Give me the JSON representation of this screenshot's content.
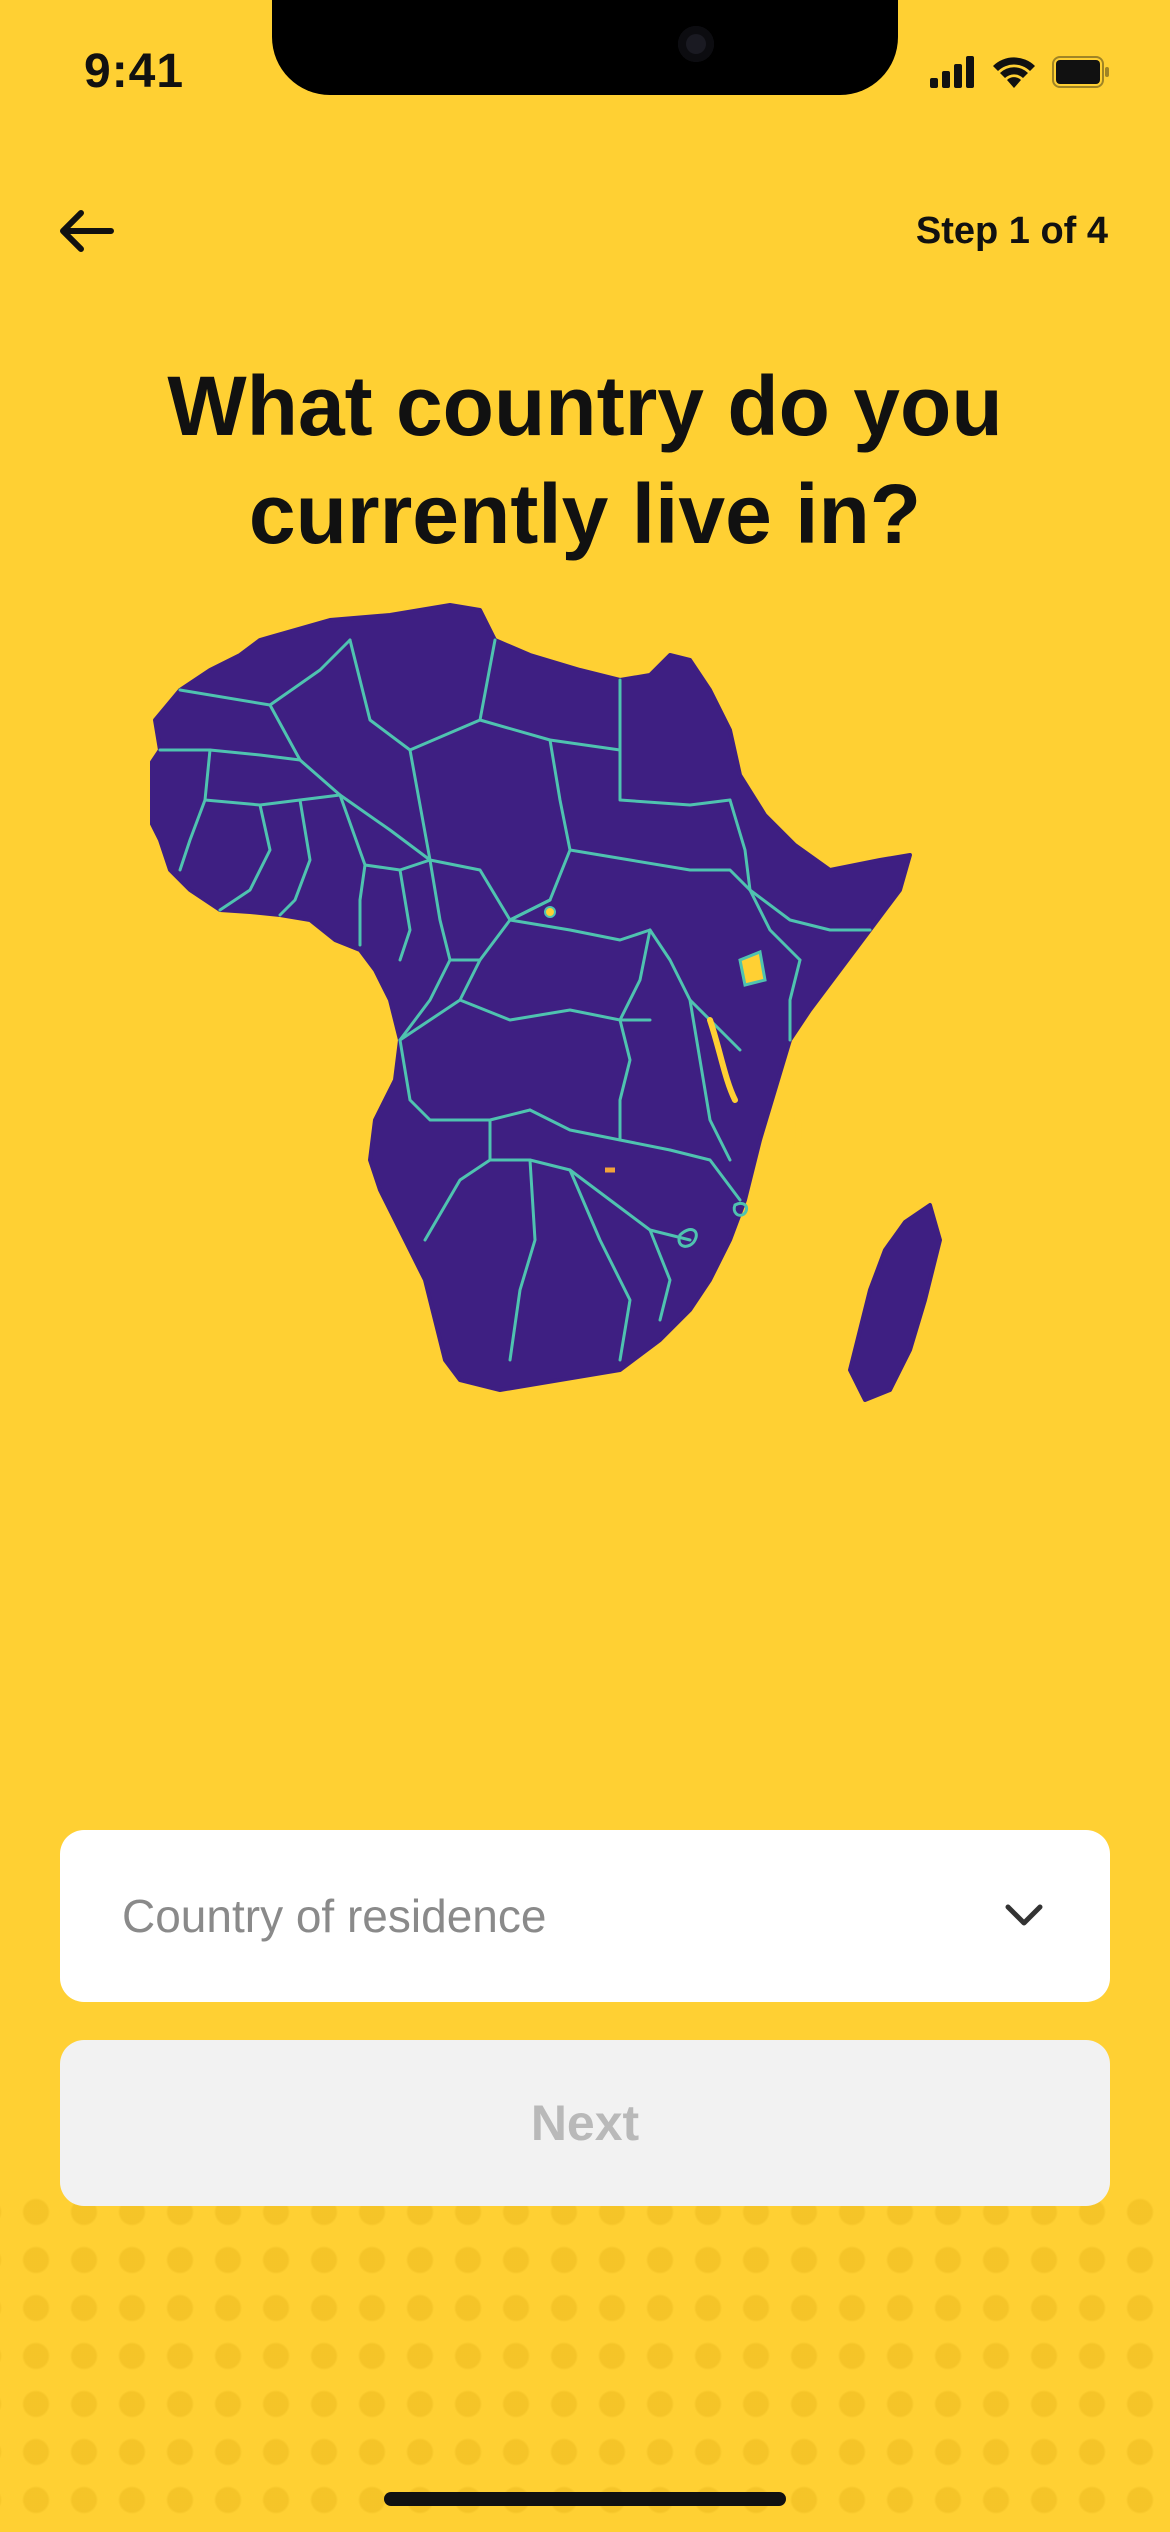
{
  "status_bar": {
    "time": "9:41"
  },
  "header": {
    "step": "Step 1 of 4"
  },
  "title": {
    "line1": "What country do you",
    "line2": "currently live in?"
  },
  "country_select": {
    "placeholder": "Country of residence"
  },
  "next_button": {
    "label": "Next",
    "enabled": false
  },
  "colors": {
    "background": "#FFD033",
    "map_fill": "#3E1F82",
    "map_border": "#4FC3B0",
    "button_disabled_bg": "#F2F2F2",
    "button_disabled_text": "#B9B9B9"
  },
  "icons": {
    "back": "arrow-left-icon",
    "chevron": "chevron-down-icon"
  }
}
